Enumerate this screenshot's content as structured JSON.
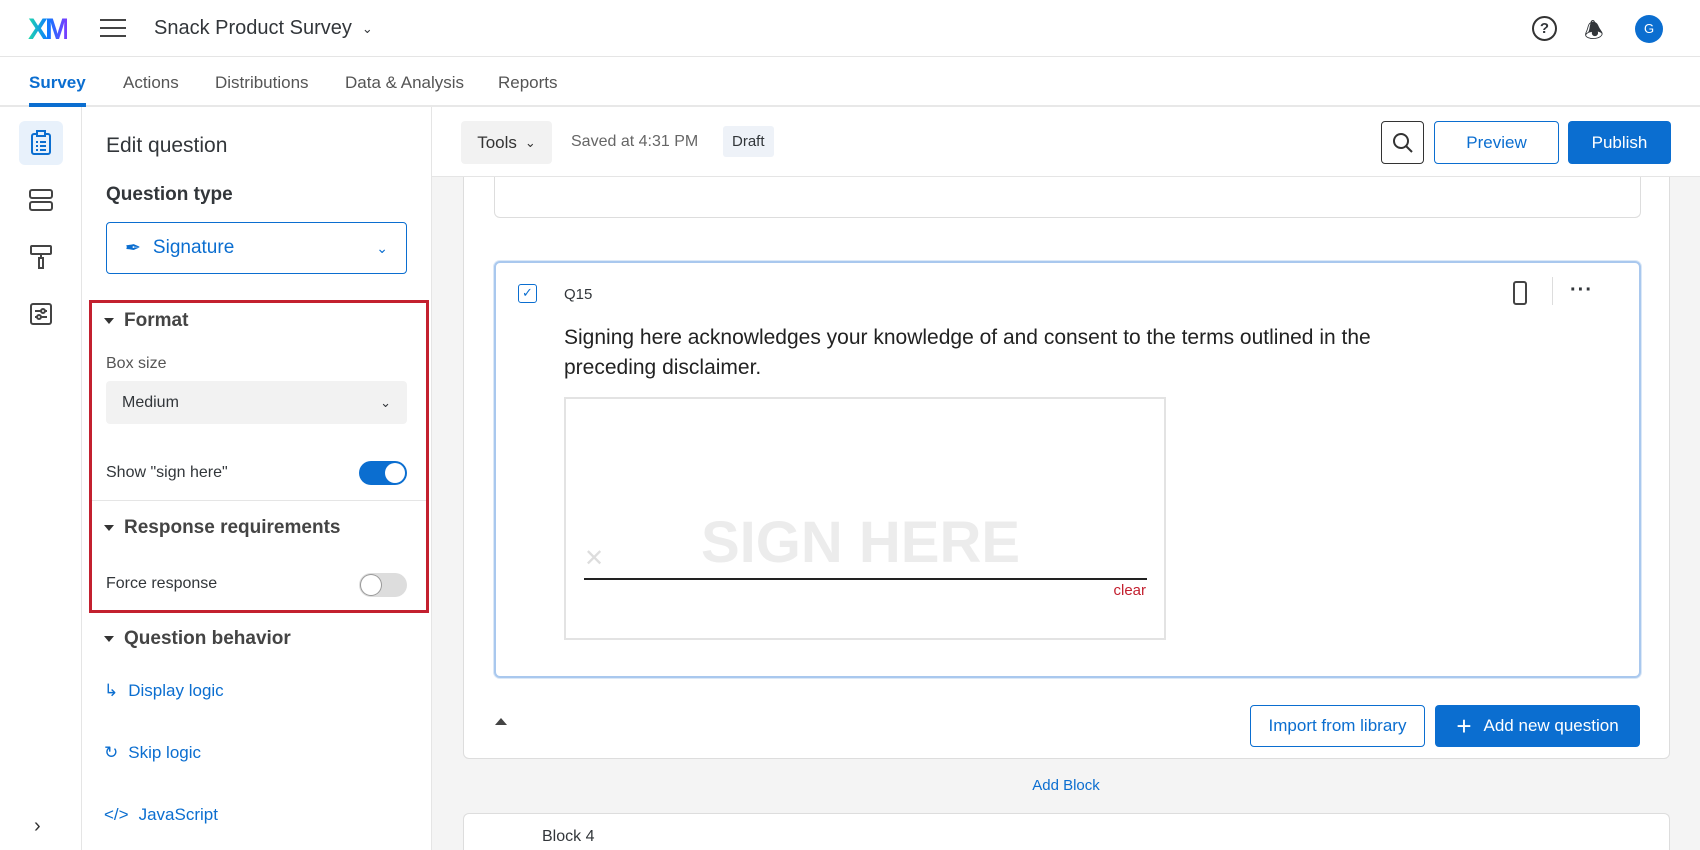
{
  "header": {
    "logo": "XM",
    "survey_title": "Snack Product Survey",
    "avatar_initial": "G"
  },
  "tabs": [
    {
      "label": "Survey"
    },
    {
      "label": "Actions"
    },
    {
      "label": "Distributions"
    },
    {
      "label": "Data & Analysis"
    },
    {
      "label": "Reports"
    }
  ],
  "panel": {
    "title": "Edit question",
    "question_type_label": "Question type",
    "question_type_value": "Signature",
    "format": {
      "heading": "Format",
      "box_size_label": "Box size",
      "box_size_value": "Medium",
      "show_sign_here_label": "Show \"sign here\"",
      "show_sign_here_on": true
    },
    "response": {
      "heading": "Response requirements",
      "force_response_label": "Force response",
      "force_response_on": false
    },
    "behavior": {
      "heading": "Question behavior",
      "display_logic": "Display logic",
      "skip_logic": "Skip logic",
      "javascript": "JavaScript"
    }
  },
  "toolbar": {
    "tools_label": "Tools",
    "saved_text": "Saved at 4:31 PM",
    "status_badge": "Draft",
    "preview_label": "Preview",
    "publish_label": "Publish"
  },
  "question": {
    "number": "Q15",
    "text": "Signing here acknowledges your knowledge of and consent to the terms outlined in the preceding disclaimer.",
    "sign_here": "SIGN HERE",
    "clear_label": "clear"
  },
  "block_actions": {
    "import_label": "Import from library",
    "add_question_label": "Add new question",
    "add_block_label": "Add Block"
  },
  "next_block": {
    "title": "Block 4"
  },
  "colors": {
    "accent": "#0b6ed0",
    "highlight": "#c3202f"
  }
}
